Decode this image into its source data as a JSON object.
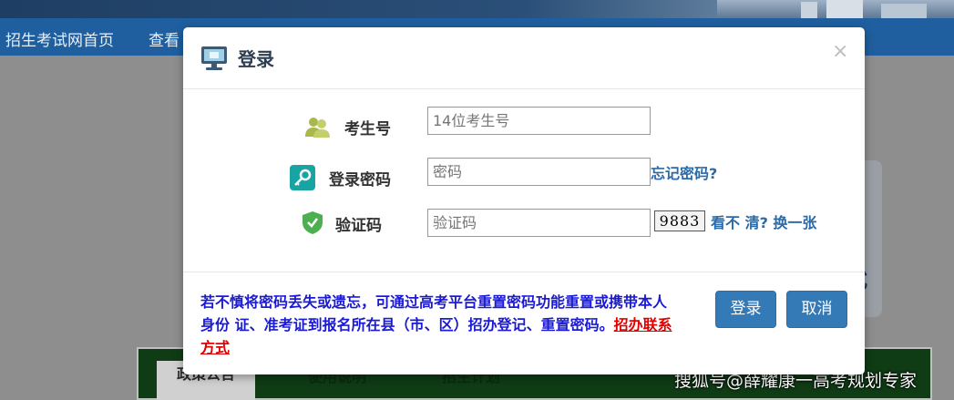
{
  "background": {
    "nav": [
      "招生考试网首页",
      "查看"
    ],
    "right_card_text": "式",
    "tabs": [
      "政策公告",
      "使用说明",
      "招生计划"
    ],
    "watermark": "搜狐号@薛耀康一高考规划专家"
  },
  "modal": {
    "title": "登录",
    "close": "×",
    "fields": {
      "exam_no": {
        "label": "考生号",
        "placeholder": "14位考生号"
      },
      "password": {
        "label": "登录密码",
        "placeholder": "密码"
      },
      "captcha": {
        "label": "验证码",
        "placeholder": "验证码"
      }
    },
    "forgot_password": "忘记密码?",
    "captcha_code": "9883",
    "refresh_captcha": "看不 清? 换一张",
    "notice": "若不慎将密码丢失或遗忘，可通过高考平台重置密码功能重置或携带本人身份 证、准考证到报名所在县（市、区）招办登记、重置密码。",
    "notice_link": "招办联系方式",
    "buttons": {
      "login": "登录",
      "cancel": "取消"
    }
  },
  "colors": {
    "primary_button": "#337ab7",
    "notice_text": "#1a1ad6",
    "notice_link": "#e00000",
    "link": "#2a6aa8",
    "nav_bg": "#1f5f9f"
  },
  "icons": [
    "monitor-icon",
    "users-icon",
    "key-icon",
    "shield-check-icon",
    "close-icon"
  ]
}
